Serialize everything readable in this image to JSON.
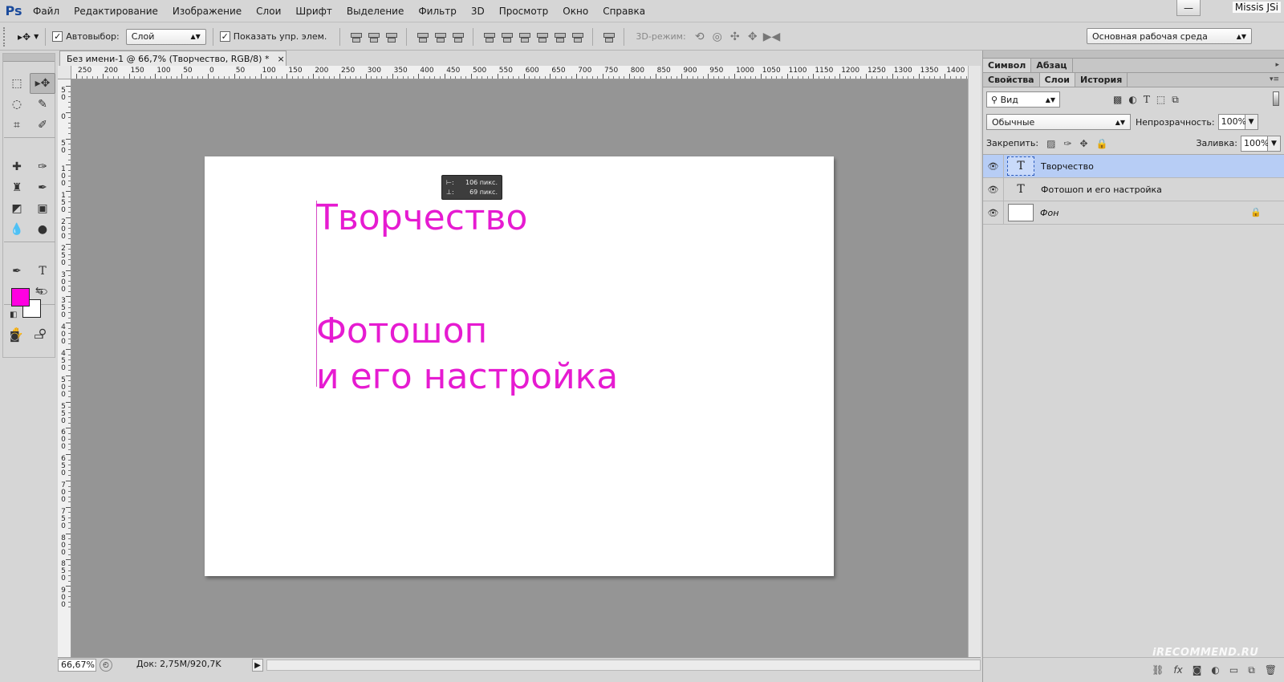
{
  "app": {
    "logo": "Ps",
    "user": "Missis JSi",
    "minimize_glyph": "—"
  },
  "menu": [
    "Файл",
    "Редактирование",
    "Изображение",
    "Слои",
    "Шрифт",
    "Выделение",
    "Фильтр",
    "3D",
    "Просмотр",
    "Окно",
    "Справка"
  ],
  "options": {
    "autoselect_label": "Автовыбор:",
    "autoselect_value": "Слой",
    "show_controls_label": "Показать упр. элем.",
    "mode3d_label": "3D-режим:",
    "workspace": "Основная рабочая среда"
  },
  "document": {
    "tab_title": "Без имени-1 @ 66,7% (Творчество, RGB/8) *",
    "text1": "Творчество",
    "text2": "Фотошоп",
    "text3": "и его настройка",
    "text_color": "#e61bd1",
    "tooltip_w": "106 пикс.",
    "tooltip_h": "69 пикс."
  },
  "ruler": {
    "top_labels": [
      "250",
      "200",
      "150",
      "100",
      "50",
      "0",
      "50",
      "100",
      "150",
      "200",
      "250",
      "300",
      "350",
      "400",
      "450",
      "500",
      "550",
      "600",
      "650",
      "700",
      "750",
      "800",
      "850",
      "900",
      "950",
      "1000",
      "1050",
      "1100",
      "1150",
      "1200",
      "1250",
      "1300",
      "1350",
      "1400"
    ],
    "left_labels": [
      "50",
      "0",
      "50",
      "100",
      "150",
      "200",
      "250",
      "300",
      "350",
      "400",
      "450",
      "500",
      "550",
      "600",
      "650",
      "700",
      "750",
      "800",
      "850",
      "900"
    ]
  },
  "status": {
    "zoom": "66,67%",
    "doc_info": "Док: 2,75M/920,7K"
  },
  "panels": {
    "top_tabs": [
      "Символ",
      "Абзац"
    ],
    "tabs": [
      "Свойства",
      "Слои",
      "История"
    ],
    "filter_value": "Вид",
    "blend_mode": "Обычные",
    "opacity_label": "Непрозрачность:",
    "opacity": "100%",
    "lock_label": "Закрепить:",
    "fill_label": "Заливка:",
    "fill": "100%"
  },
  "layers": [
    {
      "name": "Творчество",
      "type": "text",
      "selected": true
    },
    {
      "name": "Фотошоп и его настройка",
      "type": "text",
      "selected": false
    },
    {
      "name": "Фон",
      "type": "background",
      "selected": false
    }
  ],
  "watermark": "iRECOMMEND.RU",
  "colors": {
    "foreground": "#ff00e1",
    "background": "#ffffff",
    "selection": "#b7cdf5"
  }
}
